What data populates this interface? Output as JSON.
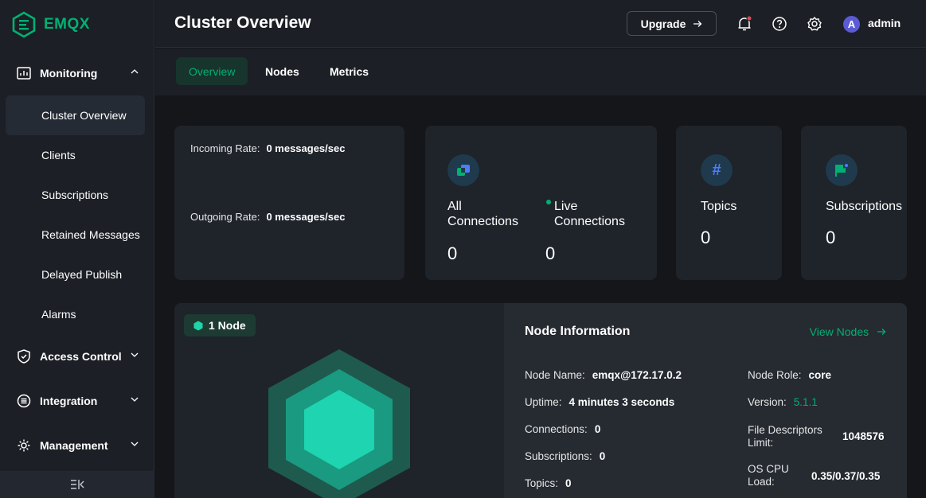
{
  "brand": {
    "name": "EMQX",
    "color": "#00b173"
  },
  "sidebar": {
    "groups": [
      {
        "label": "Monitoring",
        "icon": "monitoring-icon",
        "expanded": true
      },
      {
        "label": "Access Control",
        "icon": "shield-icon",
        "expanded": false
      },
      {
        "label": "Integration",
        "icon": "integration-icon",
        "expanded": false
      },
      {
        "label": "Management",
        "icon": "management-icon",
        "expanded": false
      }
    ],
    "items": [
      {
        "label": "Cluster Overview",
        "active": true
      },
      {
        "label": "Clients"
      },
      {
        "label": "Subscriptions"
      },
      {
        "label": "Retained Messages"
      },
      {
        "label": "Delayed Publish"
      },
      {
        "label": "Alarms"
      }
    ],
    "collapse_icon": "collapse-sidebar-icon"
  },
  "header": {
    "title": "Cluster Overview",
    "upgrade_label": "Upgrade",
    "user": {
      "initial": "A",
      "name": "admin"
    }
  },
  "tabs": [
    {
      "label": "Overview",
      "active": true
    },
    {
      "label": "Nodes"
    },
    {
      "label": "Metrics"
    }
  ],
  "rates": {
    "incoming_label": "Incoming Rate:",
    "incoming_value": "0 messages/sec",
    "outgoing_label": "Outgoing Rate:",
    "outgoing_value": "0 messages/sec"
  },
  "stats": {
    "all_connections": {
      "label": "All Connections",
      "value": "0"
    },
    "live_connections": {
      "label": "Live Connections",
      "value": "0"
    },
    "topics": {
      "label": "Topics",
      "value": "0"
    },
    "subscriptions": {
      "label": "Subscriptions",
      "value": "0"
    }
  },
  "nodes": {
    "badge": "1 Node",
    "info_title": "Node Information",
    "view_nodes": "View Nodes",
    "left": [
      {
        "label": "Node Name:",
        "value": "emqx@172.17.0.2"
      },
      {
        "label": "Uptime:",
        "value": "4 minutes 3 seconds"
      },
      {
        "label": "Connections:",
        "value": "0"
      },
      {
        "label": "Subscriptions:",
        "value": "0"
      },
      {
        "label": "Topics:",
        "value": "0"
      }
    ],
    "right": [
      {
        "label": "Node Role:",
        "value": "core"
      },
      {
        "label": "Version:",
        "value": "5.1.1"
      },
      {
        "label": "File Descriptors Limit:",
        "value": "1048576"
      },
      {
        "label": "OS CPU Load:",
        "value": "0.35/0.37/0.35"
      }
    ]
  }
}
